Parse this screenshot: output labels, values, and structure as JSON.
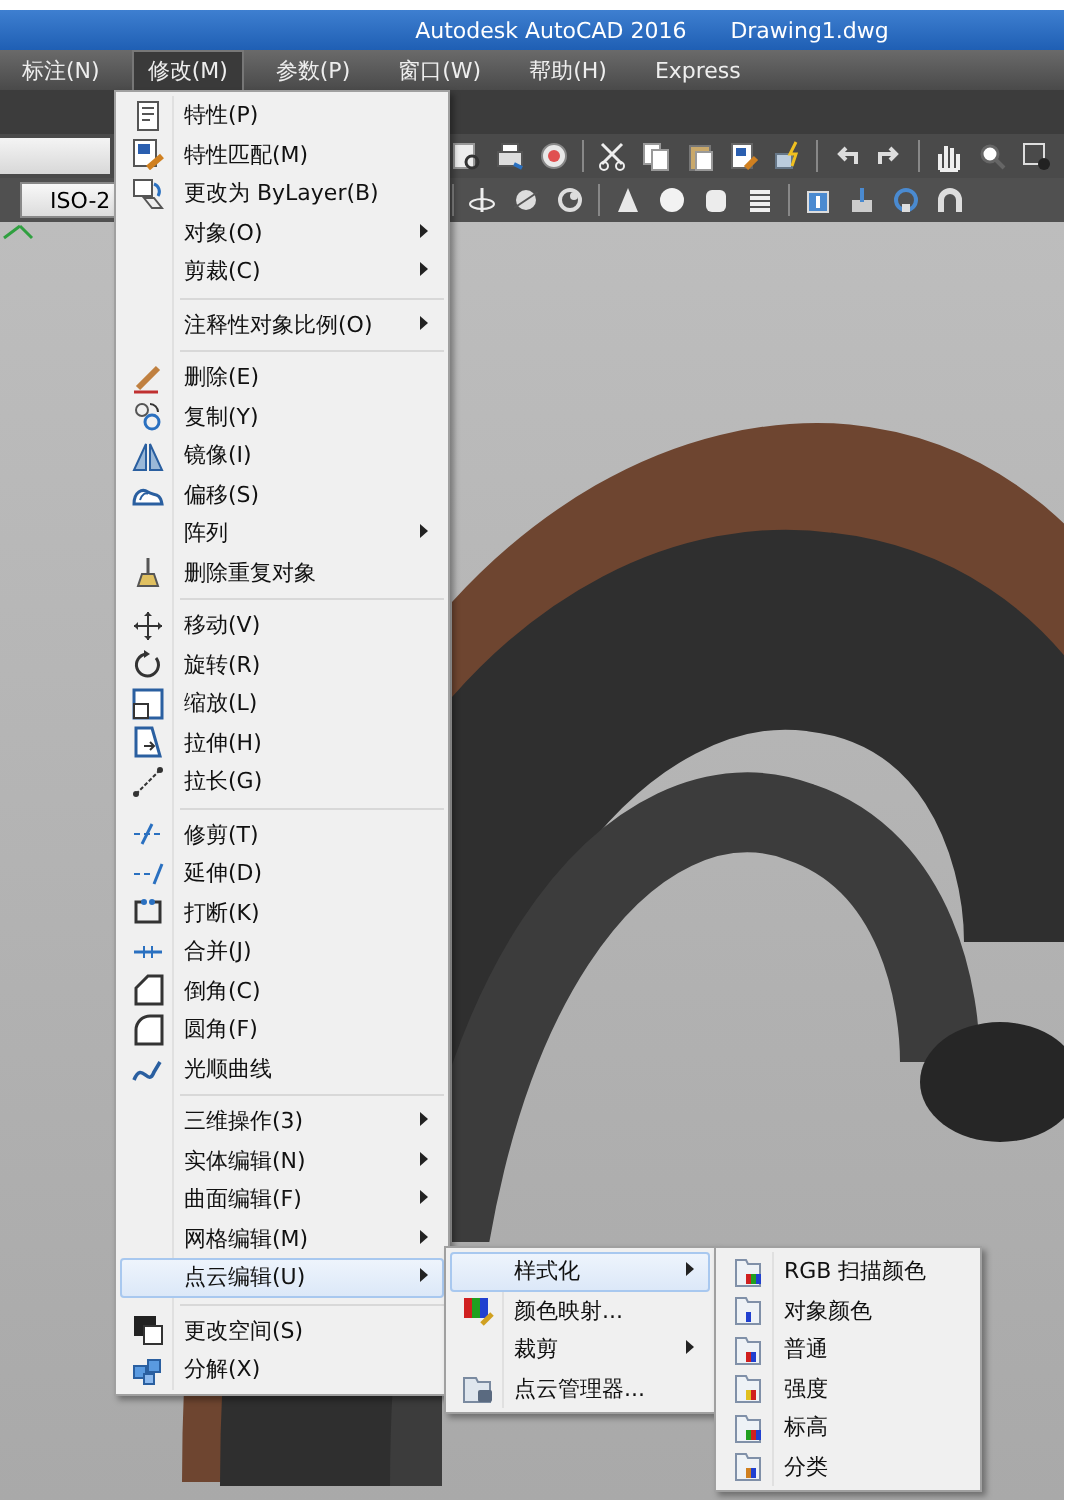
{
  "title_bar": {
    "app": "Autodesk AutoCAD 2016",
    "document": "Drawing1.dwg"
  },
  "menu_bar": [
    {
      "label": "标注(N)",
      "selected": false
    },
    {
      "label": "修改(M)",
      "selected": true
    },
    {
      "label": "参数(P)",
      "selected": false
    },
    {
      "label": "窗口(W)",
      "selected": false
    },
    {
      "label": "帮助(H)",
      "selected": false
    },
    {
      "label": "Express",
      "selected": false
    }
  ],
  "toolbar": {
    "style_field": "ISO-2"
  },
  "menu": {
    "groups": [
      {
        "items": [
          {
            "label": "特性(P)",
            "has_icon": true,
            "submenu": false,
            "selected": false
          },
          {
            "label": "特性匹配(M)",
            "has_icon": true,
            "submenu": false,
            "selected": false
          },
          {
            "label": "更改为 ByLayer(B)",
            "has_icon": true,
            "submenu": false,
            "selected": false
          },
          {
            "label": "对象(O)",
            "has_icon": false,
            "submenu": true,
            "selected": false
          },
          {
            "label": "剪裁(C)",
            "has_icon": false,
            "submenu": true,
            "selected": false
          }
        ]
      },
      {
        "items": [
          {
            "label": "注释性对象比例(O)",
            "has_icon": false,
            "submenu": true,
            "selected": false
          }
        ]
      },
      {
        "items": [
          {
            "label": "删除(E)",
            "has_icon": true,
            "submenu": false,
            "selected": false
          },
          {
            "label": "复制(Y)",
            "has_icon": true,
            "submenu": false,
            "selected": false
          },
          {
            "label": "镜像(I)",
            "has_icon": true,
            "submenu": false,
            "selected": false
          },
          {
            "label": "偏移(S)",
            "has_icon": true,
            "submenu": false,
            "selected": false
          },
          {
            "label": "阵列",
            "has_icon": false,
            "submenu": true,
            "selected": false
          },
          {
            "label": "删除重复对象",
            "has_icon": true,
            "submenu": false,
            "selected": false
          }
        ]
      },
      {
        "items": [
          {
            "label": "移动(V)",
            "has_icon": true,
            "submenu": false,
            "selected": false
          },
          {
            "label": "旋转(R)",
            "has_icon": true,
            "submenu": false,
            "selected": false
          },
          {
            "label": "缩放(L)",
            "has_icon": true,
            "submenu": false,
            "selected": false
          },
          {
            "label": "拉伸(H)",
            "has_icon": true,
            "submenu": false,
            "selected": false
          },
          {
            "label": "拉长(G)",
            "has_icon": true,
            "submenu": false,
            "selected": false
          }
        ]
      },
      {
        "items": [
          {
            "label": "修剪(T)",
            "has_icon": true,
            "submenu": false,
            "selected": false
          },
          {
            "label": "延伸(D)",
            "has_icon": true,
            "submenu": false,
            "selected": false
          },
          {
            "label": "打断(K)",
            "has_icon": true,
            "submenu": false,
            "selected": false
          },
          {
            "label": "合并(J)",
            "has_icon": true,
            "submenu": false,
            "selected": false
          },
          {
            "label": "倒角(C)",
            "has_icon": true,
            "submenu": false,
            "selected": false
          },
          {
            "label": "圆角(F)",
            "has_icon": true,
            "submenu": false,
            "selected": false
          },
          {
            "label": "光顺曲线",
            "has_icon": true,
            "submenu": false,
            "selected": false
          }
        ]
      },
      {
        "items": [
          {
            "label": "三维操作(3)",
            "has_icon": false,
            "submenu": true,
            "selected": false
          },
          {
            "label": "实体编辑(N)",
            "has_icon": false,
            "submenu": true,
            "selected": false
          },
          {
            "label": "曲面编辑(F)",
            "has_icon": false,
            "submenu": true,
            "selected": false
          },
          {
            "label": "网格编辑(M)",
            "has_icon": false,
            "submenu": true,
            "selected": false
          },
          {
            "label": "点云编辑(U)",
            "has_icon": false,
            "submenu": true,
            "selected": true
          }
        ]
      },
      {
        "items": [
          {
            "label": "更改空间(S)",
            "has_icon": true,
            "submenu": false,
            "selected": false
          },
          {
            "label": "分解(X)",
            "has_icon": true,
            "submenu": false,
            "selected": false
          }
        ]
      }
    ]
  },
  "submenu": {
    "items": [
      {
        "label": "样式化",
        "has_icon": false,
        "submenu": true,
        "selected": true
      },
      {
        "label": "颜色映射...",
        "has_icon": true,
        "submenu": false,
        "selected": false
      },
      {
        "label": "裁剪",
        "has_icon": false,
        "submenu": true,
        "selected": false
      },
      {
        "label": "点云管理器...",
        "has_icon": true,
        "submenu": false,
        "selected": false
      }
    ]
  },
  "submenu_2": {
    "items": [
      {
        "label": "RGB 扫描颜色",
        "has_icon": true,
        "submenu": false,
        "selected": false
      },
      {
        "label": "对象颜色",
        "has_icon": true,
        "submenu": false,
        "selected": false
      },
      {
        "label": "普通",
        "has_icon": true,
        "submenu": false,
        "selected": false
      },
      {
        "label": "强度",
        "has_icon": true,
        "submenu": false,
        "selected": false
      },
      {
        "label": "标高",
        "has_icon": true,
        "submenu": false,
        "selected": false
      },
      {
        "label": "分类",
        "has_icon": true,
        "submenu": false,
        "selected": false
      }
    ]
  }
}
